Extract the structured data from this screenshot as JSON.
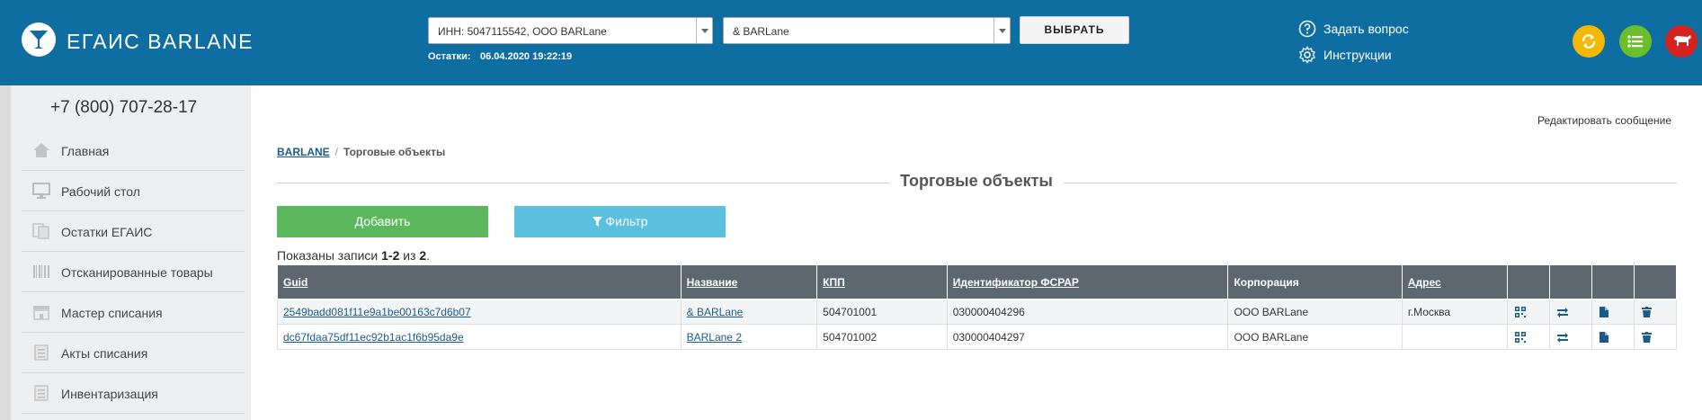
{
  "header": {
    "brand": "ЕГАИС BARLANE",
    "inn_select": "ИНН: 5047115542, ООО BARLane",
    "object_select": "& BARLane",
    "choose_button": "ВЫБРАТЬ",
    "stock_label": "Остатки:",
    "stock_date": "06.04.2020 19:22:19",
    "ask_question": "Задать вопрос",
    "instructions": "Инструкции"
  },
  "sidebar": {
    "phone": "+7 (800) 707-28-17",
    "items": [
      {
        "label": "Главная",
        "icon": "home-icon"
      },
      {
        "label": "Рабочий стол",
        "icon": "monitor-icon"
      },
      {
        "label": "Остатки ЕГАИС",
        "icon": "documents-icon"
      },
      {
        "label": "Отсканированные товары",
        "icon": "barcode-icon"
      },
      {
        "label": "Мастер списания",
        "icon": "store-icon"
      },
      {
        "label": "Акты списания",
        "icon": "document-icon"
      },
      {
        "label": "Инвентаризация",
        "icon": "document-icon"
      }
    ]
  },
  "main": {
    "edit_message": "Редактировать сообщение",
    "breadcrumb_root": "BARLANE",
    "breadcrumb_sep": "/",
    "breadcrumb_current": "Торговые объекты",
    "title": "Торговые объекты",
    "add_button": "Добавить",
    "filter_button": "Фильтр",
    "shown_prefix": "Показаны записи",
    "shown_range": "1-2",
    "shown_of": "из",
    "shown_total": "2",
    "shown_dot": "."
  },
  "table": {
    "columns": [
      "Guid",
      "Название",
      "КПП",
      "Идентификатор ФСРАР",
      "Корпорация",
      "Адрес"
    ],
    "rows": [
      {
        "guid": "2549badd081f11e9a1be00163c7d6b07",
        "name": "& BARLane",
        "kpp": "504701001",
        "fsrar": "030000404296",
        "corp": "ООО BARLane",
        "address": "г.Москва"
      },
      {
        "guid": "dc67fdaa75df11ec92b1ac1f6b95da9e",
        "name": "BARLane 2",
        "kpp": "504701002",
        "fsrar": "030000404297",
        "corp": "ООО BARLane",
        "address": ""
      }
    ]
  },
  "colors": {
    "header_bg": "#0e6ea1",
    "add_green": "#5cb85c",
    "filter_blue": "#5bc0de",
    "table_header": "#5e6670",
    "sync_yellow": "#f5b800",
    "list_green": "#6abf2a",
    "cow_red": "#d72222"
  }
}
